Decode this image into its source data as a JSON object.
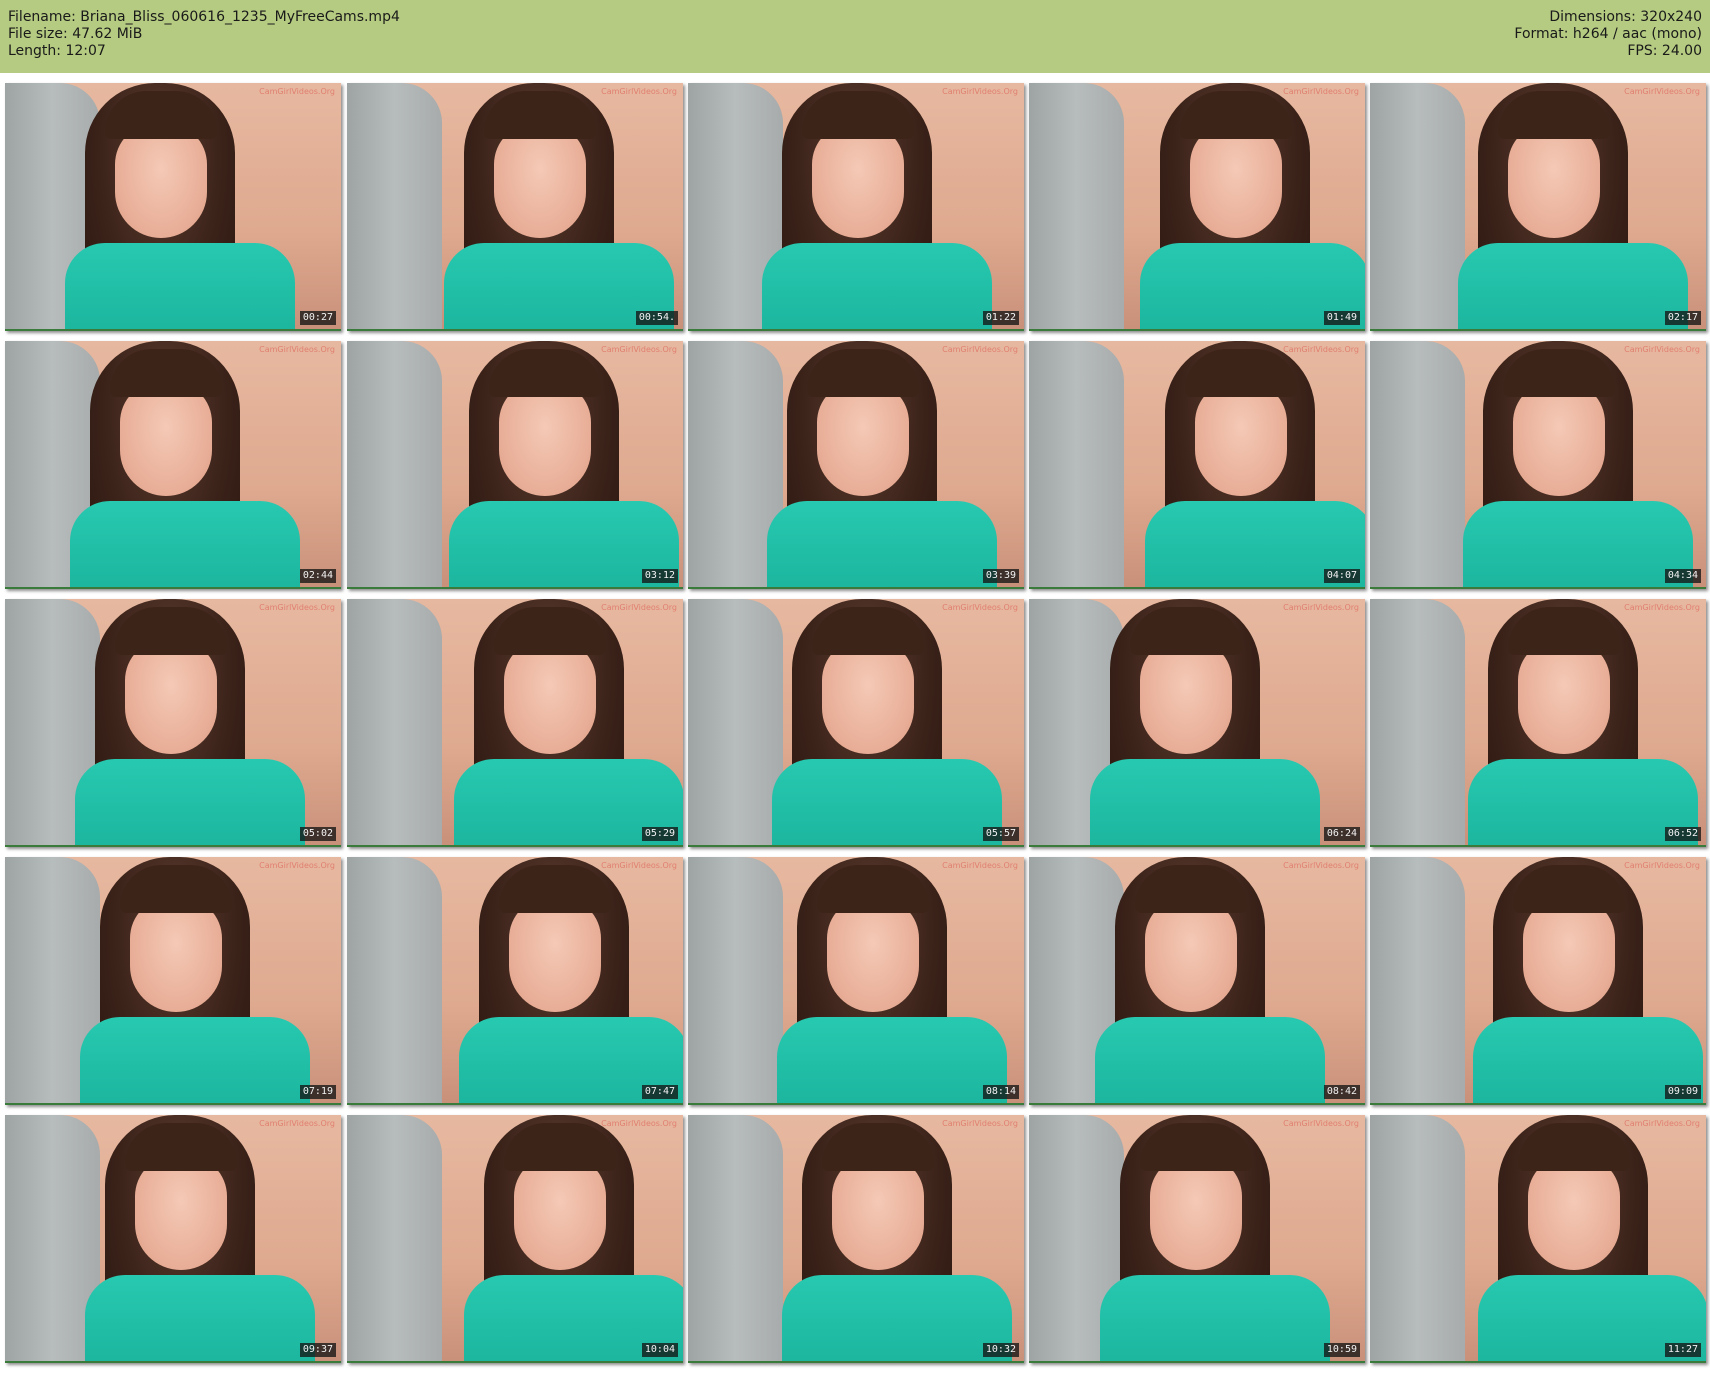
{
  "header": {
    "filename": "Filename: Briana_Bliss_060616_1235_MyFreeCams.mp4",
    "filesize": "File size: 47.62 MiB",
    "length": "Length: 12:07",
    "dimensions": "Dimensions: 320x240",
    "format": "Format: h264 / aac (mono)",
    "fps": "FPS: 24.00"
  },
  "colors": {
    "header_bg": "#b5cb81",
    "timestamp_bg": "#141414",
    "shirt": "#1bb39c"
  },
  "thumbnails": [
    "00:27",
    "00:54.",
    "01:22",
    "01:49",
    "02:17",
    "02:44",
    "03:12",
    "03:39",
    "04:07",
    "04:34",
    "05:02",
    "05:29",
    "05:57",
    "06:24",
    "06:52",
    "07:19",
    "07:47",
    "08:14",
    "08:42",
    "09:09",
    "09:37",
    "10:04",
    "10:32",
    "10:59",
    "11:27"
  ],
  "watermark": "CamGirlVideos.Org"
}
